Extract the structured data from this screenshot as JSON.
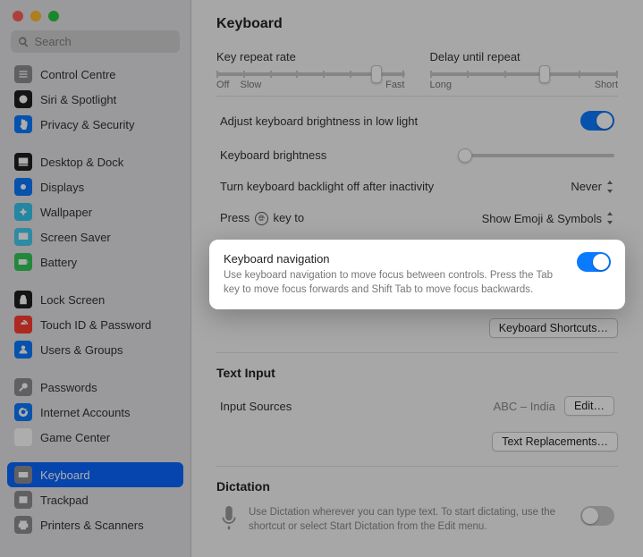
{
  "search": {
    "placeholder": "Search"
  },
  "sidebar": {
    "groups": [
      {
        "items": [
          {
            "label": "Control Centre",
            "icon": "sliders",
            "bg": "#8e8e93"
          },
          {
            "label": "Siri & Spotlight",
            "icon": "siri",
            "bg": "#1e1e1e"
          },
          {
            "label": "Privacy & Security",
            "icon": "hand",
            "bg": "#0a7aff"
          }
        ]
      },
      {
        "items": [
          {
            "label": "Desktop & Dock",
            "icon": "dock",
            "bg": "#1e1e1e"
          },
          {
            "label": "Displays",
            "icon": "sun",
            "bg": "#0a7aff"
          },
          {
            "label": "Wallpaper",
            "icon": "flower",
            "bg": "#34c7f0"
          },
          {
            "label": "Screen Saver",
            "icon": "screensaver",
            "bg": "#46ccf0"
          },
          {
            "label": "Battery",
            "icon": "battery",
            "bg": "#34c759"
          }
        ]
      },
      {
        "items": [
          {
            "label": "Lock Screen",
            "icon": "lock",
            "bg": "#1e1e1e"
          },
          {
            "label": "Touch ID & Password",
            "icon": "fingerprint",
            "bg": "#ff3b30"
          },
          {
            "label": "Users & Groups",
            "icon": "users",
            "bg": "#0a7aff"
          }
        ]
      },
      {
        "items": [
          {
            "label": "Passwords",
            "icon": "key",
            "bg": "#8e8e93"
          },
          {
            "label": "Internet Accounts",
            "icon": "at",
            "bg": "#0a7aff"
          },
          {
            "label": "Game Center",
            "icon": "gamecenter",
            "bg": "#ffffff"
          }
        ]
      },
      {
        "items": [
          {
            "label": "Keyboard",
            "icon": "keyboard",
            "bg": "#8e8e93",
            "selected": true
          },
          {
            "label": "Trackpad",
            "icon": "trackpad",
            "bg": "#8e8e93"
          },
          {
            "label": "Printers & Scanners",
            "icon": "printer",
            "bg": "#8e8e93"
          }
        ]
      }
    ]
  },
  "main": {
    "title": "Keyboard",
    "keyRepeat": {
      "label": "Key repeat rate",
      "left": "Off",
      "left2": "Slow",
      "right": "Fast"
    },
    "delayRepeat": {
      "label": "Delay until repeat",
      "left": "Long",
      "right": "Short"
    },
    "adjustBrightness": {
      "label": "Adjust keyboard brightness in low light",
      "on": true
    },
    "keyboardBrightness": {
      "label": "Keyboard brightness"
    },
    "backlightOff": {
      "label": "Turn keyboard backlight off after inactivity",
      "value": "Never"
    },
    "globeKey": {
      "prefix": "Press ",
      "suffix": " key to",
      "value": "Show Emoji & Symbols"
    },
    "keyboardNav": {
      "title": "Keyboard navigation",
      "desc": "Use keyboard navigation to move focus between controls. Press the Tab key to move focus forwards and Shift Tab to move focus backwards.",
      "on": true
    },
    "keyboardShortcutsBtn": "Keyboard Shortcuts…",
    "textInput": {
      "title": "Text Input",
      "inputSourcesLabel": "Input Sources",
      "inputSourcesValue": "ABC – India",
      "editBtn": "Edit…",
      "textReplacementsBtn": "Text Replacements…"
    },
    "dictation": {
      "title": "Dictation",
      "desc": "Use Dictation wherever you can type text. To start dictating, use the shortcut or select Start Dictation from the Edit menu.",
      "on": false
    }
  }
}
